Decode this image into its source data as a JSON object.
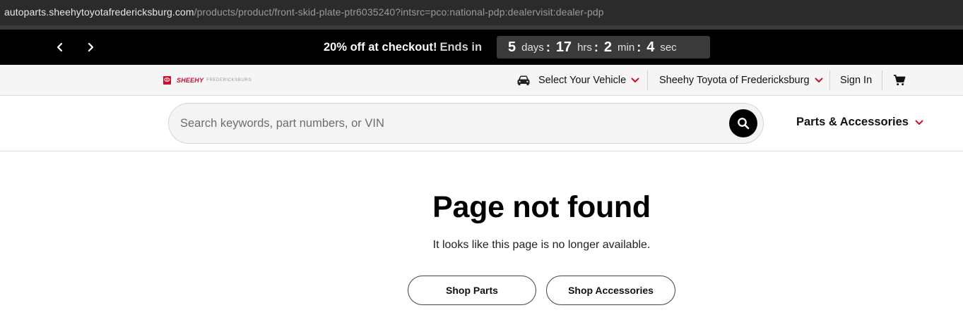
{
  "browser": {
    "url_host": "autoparts.sheehytoyotafredericksburg.com",
    "url_path": "/products/product/front-skid-plate-ptr6035240?intsrc=pco:national-pdp:dealervisit:dealer-pdp"
  },
  "promo": {
    "message": "20% off at checkout!",
    "ends_label": "Ends in",
    "countdown": {
      "days": "5",
      "days_unit": "days",
      "hrs": "17",
      "hrs_unit": "hrs",
      "min": "2",
      "min_unit": "min",
      "sec": "4",
      "sec_unit": "sec",
      "separator": ":"
    }
  },
  "dealer": {
    "logo_brand": "SHEEHY",
    "logo_location": "FREDERICKSBURG",
    "select_vehicle": "Select Your Vehicle",
    "dealer_name": "Sheehy Toyota of Fredericksburg",
    "sign_in": "Sign In"
  },
  "search": {
    "placeholder": "Search keywords, part numbers, or VIN",
    "value": ""
  },
  "parts_menu": {
    "label": "Parts & Accessories"
  },
  "main": {
    "title": "Page not found",
    "subtitle": "It looks like this page is no longer available.",
    "buttons": [
      {
        "label": "Shop Parts"
      },
      {
        "label": "Shop Accessories"
      }
    ]
  },
  "colors": {
    "accent_red": "#c8102e",
    "promo_bg": "#000000",
    "header_bg": "#f5f5f5"
  },
  "icons": {
    "prev": "chevron-left-icon",
    "next": "chevron-right-icon",
    "car": "car-icon",
    "cart": "cart-icon",
    "search": "search-icon"
  }
}
